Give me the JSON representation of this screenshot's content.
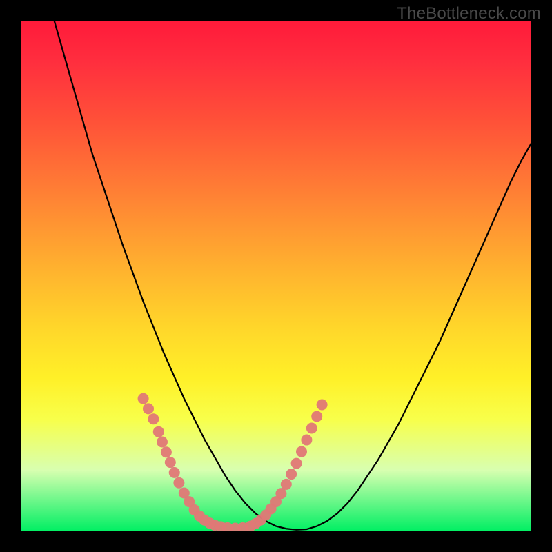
{
  "watermark": "TheBottleneck.com",
  "colors": {
    "curve_stroke": "#000000",
    "marker_fill": "#e07876",
    "marker_stroke": "#e07876",
    "frame_bg": "#000000"
  },
  "chart_data": {
    "type": "line",
    "title": "",
    "xlabel": "",
    "ylabel": "",
    "xlim": [
      0,
      100
    ],
    "ylim": [
      0,
      100
    ],
    "grid": false,
    "legend": false,
    "series": [
      {
        "name": "bottleneck-curve",
        "shape": "v-curve",
        "x": [
          0,
          2,
          4,
          6,
          8,
          10,
          12,
          14,
          16,
          18,
          20,
          22,
          24,
          26,
          28,
          30,
          32,
          34,
          36,
          38,
          40,
          42,
          44,
          46,
          48,
          50,
          52,
          54,
          56,
          58,
          60,
          62,
          64,
          66,
          68,
          70,
          72,
          74,
          76,
          78,
          80,
          82,
          84,
          86,
          88,
          90,
          92,
          94,
          96,
          98,
          100
        ],
        "y": [
          null,
          null,
          null,
          102,
          95,
          88,
          81,
          74,
          68,
          62,
          56,
          50.5,
          45,
          40,
          35,
          30.5,
          26,
          22,
          18,
          14.5,
          11,
          8,
          5.5,
          3.5,
          2,
          1,
          0.5,
          0.3,
          0.4,
          1,
          2,
          3.5,
          5.5,
          8,
          11,
          14,
          17.5,
          21,
          25,
          29,
          33,
          37,
          41.5,
          46,
          50.5,
          55,
          59.5,
          64,
          68.5,
          72.5,
          76
        ]
      }
    ],
    "markers": [
      {
        "group": "left-highlight",
        "points": [
          {
            "x": 24,
            "y": 26
          },
          {
            "x": 25,
            "y": 24
          },
          {
            "x": 26,
            "y": 22
          },
          {
            "x": 27,
            "y": 19.5
          },
          {
            "x": 27.7,
            "y": 17.5
          },
          {
            "x": 28.5,
            "y": 15.5
          },
          {
            "x": 29.3,
            "y": 13.5
          },
          {
            "x": 30.1,
            "y": 11.5
          },
          {
            "x": 31,
            "y": 9.5
          },
          {
            "x": 32,
            "y": 7.5
          },
          {
            "x": 33,
            "y": 5.8
          },
          {
            "x": 34,
            "y": 4.2
          }
        ]
      },
      {
        "group": "bottom-highlight",
        "points": [
          {
            "x": 35,
            "y": 3
          },
          {
            "x": 36,
            "y": 2.2
          },
          {
            "x": 37,
            "y": 1.6
          },
          {
            "x": 38,
            "y": 1.2
          },
          {
            "x": 39.2,
            "y": 0.9
          },
          {
            "x": 40.5,
            "y": 0.7
          },
          {
            "x": 42,
            "y": 0.6
          },
          {
            "x": 43.5,
            "y": 0.7
          },
          {
            "x": 45,
            "y": 1.0
          }
        ]
      },
      {
        "group": "right-highlight",
        "points": [
          {
            "x": 46,
            "y": 1.5
          },
          {
            "x": 47,
            "y": 2.2
          },
          {
            "x": 48,
            "y": 3.2
          },
          {
            "x": 49,
            "y": 4.4
          },
          {
            "x": 50,
            "y": 5.8
          },
          {
            "x": 51,
            "y": 7.4
          },
          {
            "x": 52,
            "y": 9.2
          },
          {
            "x": 53,
            "y": 11.2
          },
          {
            "x": 54,
            "y": 13.3
          },
          {
            "x": 55,
            "y": 15.6
          },
          {
            "x": 56,
            "y": 17.9
          },
          {
            "x": 57,
            "y": 20.2
          },
          {
            "x": 58,
            "y": 22.5
          },
          {
            "x": 59,
            "y": 24.8
          }
        ]
      }
    ]
  }
}
